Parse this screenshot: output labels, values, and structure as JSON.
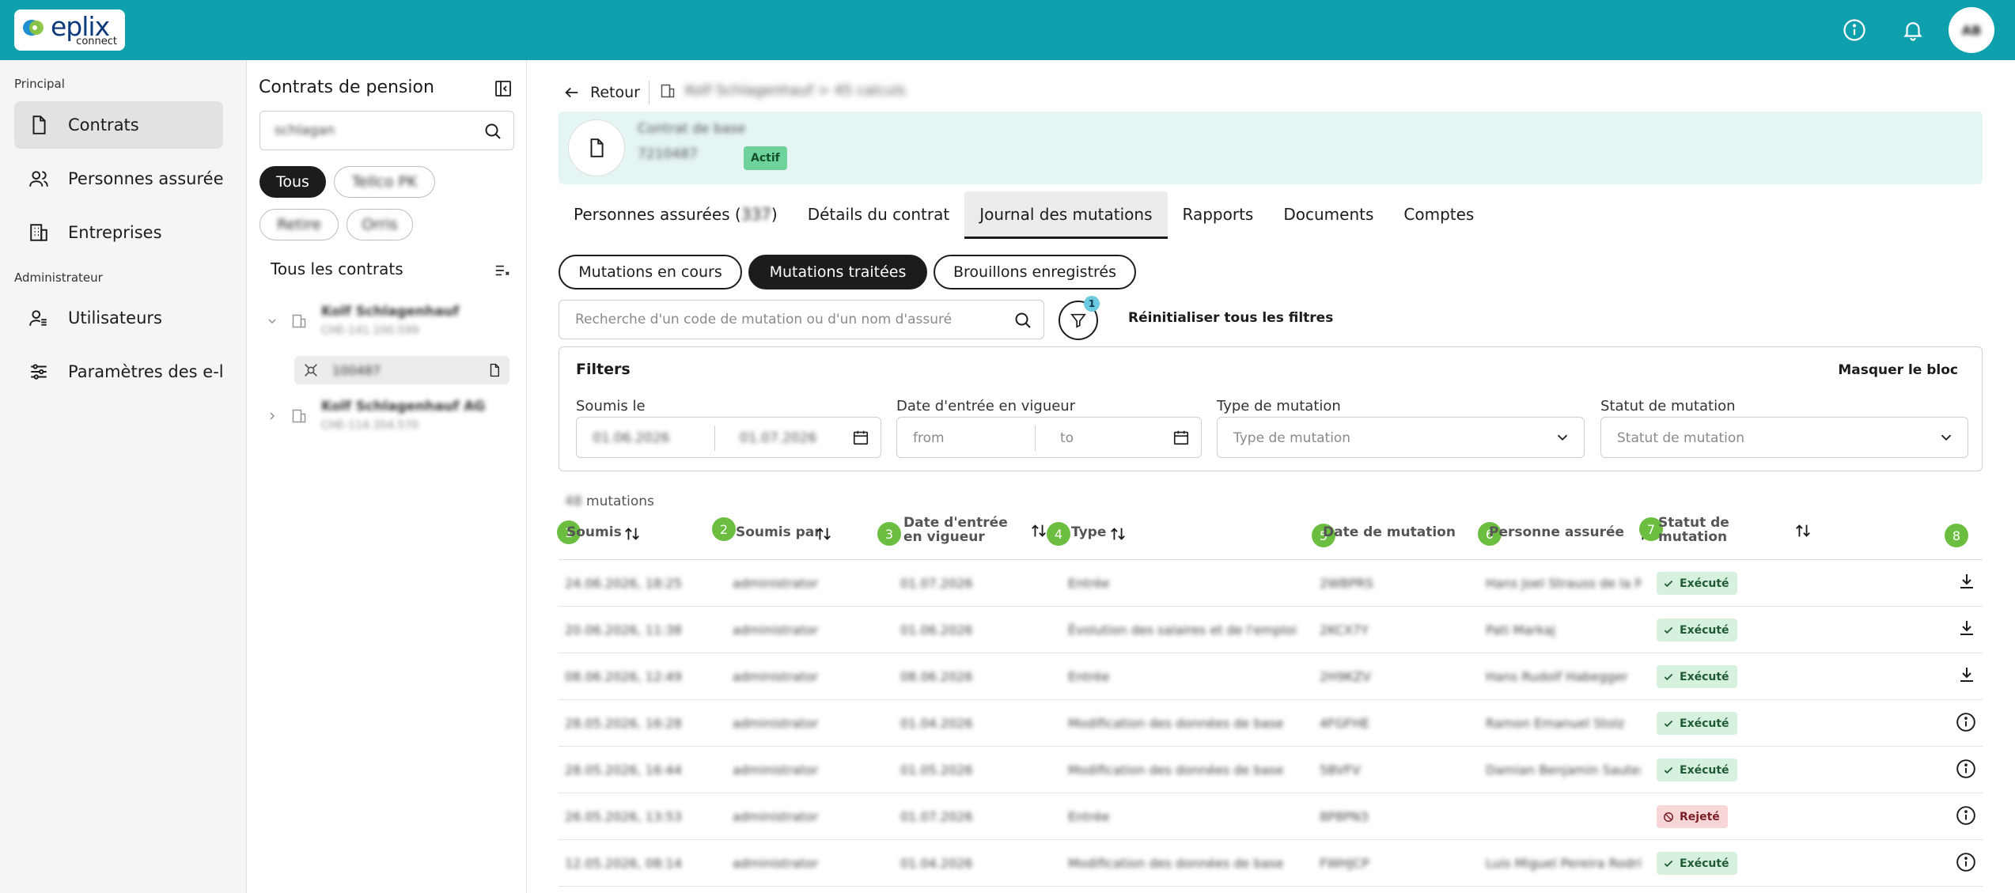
{
  "app": {
    "logo_text": "eplix",
    "logo_sub": "connect",
    "avatar_initials": "AB",
    "accent": "#0ea0ac"
  },
  "nav": {
    "section_principal": "Principal",
    "section_admin": "Administrateur",
    "items": [
      {
        "label": "Contrats",
        "icon": "file-icon"
      },
      {
        "label": "Personnes assurée",
        "icon": "users-icon"
      },
      {
        "label": "Entreprises",
        "icon": "building-icon"
      },
      {
        "label": "Utilisateurs",
        "icon": "user-admin-icon"
      },
      {
        "label": "Paramètres des e-l",
        "icon": "sliders-icon"
      }
    ]
  },
  "contracts_panel": {
    "title": "Contrats de pension",
    "search_value": "schlagan",
    "chips": [
      "Tous",
      "Tellco PK",
      "Retire",
      "Orris"
    ],
    "all_label": "Tous les contrats",
    "tree": [
      {
        "name": "Kolf Schlagenhauf",
        "code": "CHE-141.100.599"
      },
      {
        "name": "100487"
      },
      {
        "name": "Kolf Schlagenhauf AG",
        "code": "CHE-114.354.570"
      }
    ]
  },
  "main": {
    "back_label": "Retour",
    "breadcrumb": "Kolf Schlagenhauf > 45 calculs",
    "header": {
      "title": "Contrat de base",
      "number": "7210487",
      "badge": "Actif"
    },
    "tabs": [
      {
        "label": "Personnes assurées (",
        "count": "337",
        "suffix": ")"
      },
      {
        "label": "Détails du contrat"
      },
      {
        "label": "Journal des mutations"
      },
      {
        "label": "Rapports"
      },
      {
        "label": "Documents"
      },
      {
        "label": "Comptes"
      }
    ],
    "segments": [
      "Mutations en cours",
      "Mutations traitées",
      "Brouillons enregistrés"
    ],
    "search_placeholder": "Recherche d'un code de mutation ou d'un nom d'assuré",
    "filter_count": "1",
    "reset_label": "Réinitialiser tous les filtres",
    "filters": {
      "title": "Filters",
      "hide_label": "Masquer le bloc",
      "submitted_label": "Soumis le",
      "submitted_from": "01.06.2026",
      "submitted_to": "01.07.2026",
      "effective_label": "Date d'entrée en vigueur",
      "effective_from": "from",
      "effective_to": "to",
      "type_label": "Type de mutation",
      "type_placeholder": "Type de mutation",
      "status_label": "Statut de mutation",
      "status_placeholder": "Statut de mutation"
    },
    "count_value": "48",
    "count_suffix": "mutations",
    "columns": [
      {
        "n": "1",
        "label": "Soumis"
      },
      {
        "n": "2",
        "label": "Soumis par"
      },
      {
        "n": "3",
        "label": "Date d'entrée en vigueur"
      },
      {
        "n": "4",
        "label": "Type"
      },
      {
        "n": "5",
        "label": "Date de mutation"
      },
      {
        "n": "6",
        "label": "Personne assurée"
      },
      {
        "n": "7",
        "label": "Statut de mutation"
      },
      {
        "n": "8",
        "label": ""
      }
    ],
    "rows": [
      {
        "submitted": "24.06.2026, 18:25",
        "by": "administrator",
        "effective": "01.07.2026",
        "type": "Entrée",
        "code": "2WBPRS",
        "person": "Hans Joel Strauss de la Roche",
        "status": "Exécuté",
        "action": "download-icon"
      },
      {
        "submitted": "20.06.2026, 11:38",
        "by": "administrator",
        "effective": "01.06.2026",
        "type": "Évolution des salaires et de l'emploi",
        "code": "2KCX7Y",
        "person": "Pati Markaj",
        "status": "Exécuté",
        "action": "download-icon"
      },
      {
        "submitted": "08.06.2026, 12:49",
        "by": "administrator",
        "effective": "08.06.2026",
        "type": "Entrée",
        "code": "2H9KZV",
        "person": "Hans Rudolf Habegger",
        "status": "Exécuté",
        "action": "download-icon"
      },
      {
        "submitted": "28.05.2026, 16:28",
        "by": "administrator",
        "effective": "01.04.2026",
        "type": "Modification des données de base",
        "code": "4FGFHE",
        "person": "Ramon Emanuel Stolz",
        "status": "Exécuté",
        "action": "info-icon"
      },
      {
        "submitted": "28.05.2026, 16:44",
        "by": "administrator",
        "effective": "01.05.2026",
        "type": "Modification des données de base",
        "code": "5BVFV",
        "person": "Damian Benjamin Sauter",
        "status": "Exécuté",
        "action": "info-icon"
      },
      {
        "submitted": "26.05.2026, 13:53",
        "by": "administrator",
        "effective": "01.07.2026",
        "type": "Entrée",
        "code": "8P8PN3",
        "person": "",
        "status": "Rejeté",
        "action": "info-icon"
      },
      {
        "submitted": "12.05.2026, 08:14",
        "by": "administrator",
        "effective": "01.04.2026",
        "type": "Modification des données de base",
        "code": "FWHJCP",
        "person": "Luis Miguel Pereira Rodrigues",
        "status": "Exécuté",
        "action": "info-icon"
      }
    ]
  }
}
